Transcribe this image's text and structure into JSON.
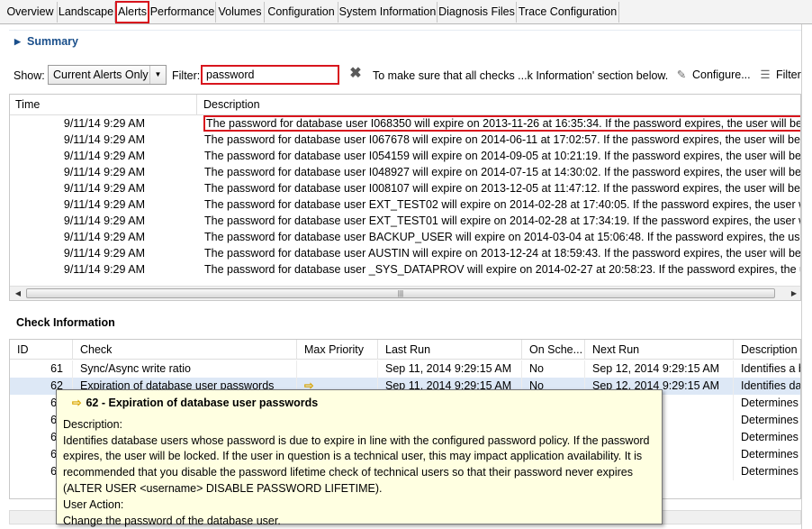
{
  "tabs": [
    {
      "label": "Overview",
      "selected": false
    },
    {
      "label": "Landscape",
      "selected": false
    },
    {
      "label": "Alerts",
      "selected": true
    },
    {
      "label": "Performance",
      "selected": false
    },
    {
      "label": "Volumes",
      "selected": false
    },
    {
      "label": "Configuration",
      "selected": false
    },
    {
      "label": "System Information",
      "selected": false
    },
    {
      "label": "Diagnosis Files",
      "selected": false
    },
    {
      "label": "Trace Configuration",
      "selected": false
    }
  ],
  "summary": {
    "label": "Summary"
  },
  "filter_bar": {
    "show_label": "Show:",
    "show_value": "Current Alerts Only",
    "filter_label": "Filter:",
    "filter_value": "password",
    "info_text": "To make sure that all checks ...k Information' section below.",
    "configure_label": "Configure...",
    "filter_button_label": "Filter"
  },
  "alerts_table": {
    "columns": [
      "Time",
      "Description"
    ],
    "rows": [
      {
        "time": "9/11/14 9:29 AM",
        "description": "The password for database user I068350 will expire on 2013-11-26 at 16:35:34. If the password expires, the user will be locked.",
        "highlighted": true
      },
      {
        "time": "9/11/14 9:29 AM",
        "description": "The password for database user I067678 will expire on 2014-06-11 at 17:02:57. If the password expires, the user will be locked."
      },
      {
        "time": "9/11/14 9:29 AM",
        "description": "The password for database user I054159 will expire on 2014-09-05 at 10:21:19. If the password expires, the user will be locked."
      },
      {
        "time": "9/11/14 9:29 AM",
        "description": "The password for database user I048927 will expire on 2014-07-15 at 14:30:02. If the password expires, the user will be locked."
      },
      {
        "time": "9/11/14 9:29 AM",
        "description": "The password for database user I008107 will expire on 2013-12-05 at 11:47:12. If the password expires, the user will be locked."
      },
      {
        "time": "9/11/14 9:29 AM",
        "description": "The password for database user EXT_TEST02 will expire on 2014-02-28 at 17:40:05. If the password expires, the user will be locke"
      },
      {
        "time": "9/11/14 9:29 AM",
        "description": "The password for database user EXT_TEST01 will expire on 2014-02-28 at 17:34:19. If the password expires, the user will be locke"
      },
      {
        "time": "9/11/14 9:29 AM",
        "description": "The password for database user BACKUP_USER will expire on 2014-03-04 at 15:06:48. If the password expires, the user will be loc"
      },
      {
        "time": "9/11/14 9:29 AM",
        "description": "The password for database user AUSTIN will expire on 2013-12-24 at 18:59:43. If the password expires, the user will be locked."
      },
      {
        "time": "9/11/14 9:29 AM",
        "description": "The password for database user _SYS_DATAPROV will expire on 2014-02-27 at 20:58:23. If the password expires, the user will be"
      }
    ]
  },
  "check_info": {
    "title": "Check Information",
    "columns": [
      "ID",
      "Check",
      "Max Priority",
      "Last Run",
      "On Sche...",
      "Next Run",
      "Description"
    ],
    "rows": [
      {
        "id": "61",
        "check": "Sync/Async write ratio",
        "priority": "",
        "last_run": "Sep 11, 2014 9:29:15 AM",
        "on_schedule": "No",
        "next_run": "Sep 12, 2014 9:29:15 AM",
        "description": "Identifies a b"
      },
      {
        "id": "62",
        "check": "Expiration of database user passwords",
        "priority": "⇨",
        "last_run": "Sep 11, 2014 9:29:15 AM",
        "on_schedule": "No",
        "next_run": "Sep 12, 2014 9:29:15 AM",
        "description": "Identifies dat",
        "selected": true
      },
      {
        "id": "64",
        "check": "",
        "priority": "",
        "last_run": "",
        "on_schedule": "",
        "next_run": "27:26 PM",
        "description": "Determines v"
      },
      {
        "id": "66",
        "check": "",
        "priority": "",
        "last_run": "",
        "on_schedule": "",
        "next_run": "50 PM",
        "description": "Determines v"
      },
      {
        "id": "67",
        "check": "",
        "priority": "",
        "last_run": "",
        "on_schedule": "",
        "next_run": "26:26 PM",
        "description": "Determines t"
      },
      {
        "id": "68",
        "check": "",
        "priority": "",
        "last_run": "",
        "on_schedule": "",
        "next_run": "28:27 PM",
        "description": "Determines t"
      },
      {
        "id": "69",
        "check": "",
        "priority": "",
        "last_run": "",
        "on_schedule": "",
        "next_run": "31:11 PM",
        "description": "Determines v"
      }
    ]
  },
  "tooltip": {
    "title": "62 - Expiration of database user passwords",
    "description_label": "Description:",
    "description": "Identifies database users whose password is due to expire in line with the configured password policy. If the password expires, the user will be locked. If the user in question is a technical user, this may impact application availability. It is recommended that you disable the password lifetime check of technical users so that their password never expires (ALTER USER <username> DISABLE PASSWORD LIFETIME).",
    "action_label": "User Action:",
    "action": "Change the password of the database user."
  },
  "colors": {
    "highlight": "#d8151d",
    "accent": "#1a4f8b",
    "tooltip_bg": "#ffffe1"
  }
}
